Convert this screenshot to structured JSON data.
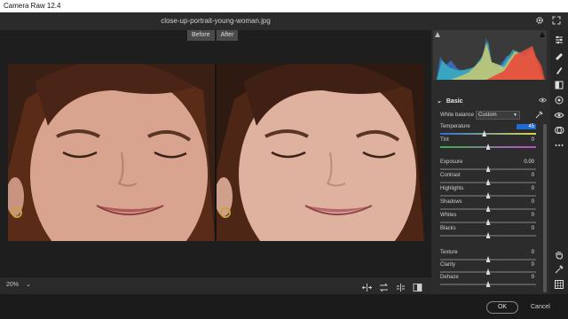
{
  "app": {
    "title": "Camera Raw 12.4"
  },
  "image": {
    "filename": "close-up-portrait-young-woman.jpg"
  },
  "viewer": {
    "before_label": "Before",
    "after_label": "After",
    "zoom": "20%"
  },
  "panel": {
    "section_title": "Basic",
    "white_balance": {
      "label": "White balance",
      "value": "Custom"
    },
    "sliders": [
      {
        "label": "Temperature",
        "value": "45",
        "level": 0.46,
        "active": true,
        "track": "temp"
      },
      {
        "label": "Tint",
        "value": "0",
        "level": 0.5,
        "track": "tint"
      },
      {
        "label": "Exposure",
        "value": "0.00",
        "level": 0.5
      },
      {
        "label": "Contrast",
        "value": "0",
        "level": 0.5
      },
      {
        "label": "Highlights",
        "value": "0",
        "level": 0.5
      },
      {
        "label": "Shadows",
        "value": "0",
        "level": 0.5
      },
      {
        "label": "Whites",
        "value": "0",
        "level": 0.5
      },
      {
        "label": "Blacks",
        "value": "0",
        "level": 0.5
      },
      {
        "label": "Texture",
        "value": "0",
        "level": 0.5
      },
      {
        "label": "Clarity",
        "value": "0",
        "level": 0.5
      },
      {
        "label": "Dehaze",
        "value": "0",
        "level": 0.5
      }
    ]
  },
  "footer": {
    "ok_label": "OK",
    "cancel_label": "Cancel"
  },
  "colors": {
    "accent": "#1e6bd1",
    "panel_bg": "#2c2c2c",
    "viewer_bg": "#1e1e1e",
    "histogram_red": "#e84a3a",
    "histogram_cyan": "#39c1c8",
    "histogram_yellow": "#e8d260",
    "histogram_blue": "#3a7ad8"
  },
  "icons": {
    "top": [
      "gear-icon",
      "fullscreen-icon"
    ],
    "tools": [
      "edit-sliders-icon",
      "healing-brush-icon",
      "mask-brush-icon",
      "gradient-icon",
      "radial-filter-icon",
      "red-eye-icon",
      "presets-icon",
      "more-icon",
      "hand-icon",
      "sampler-icon",
      "grid-icon"
    ],
    "bottom": [
      "swap-ab-icon",
      "copy-settings-icon",
      "toggle-settings-icon",
      "view-mode-icon"
    ]
  }
}
